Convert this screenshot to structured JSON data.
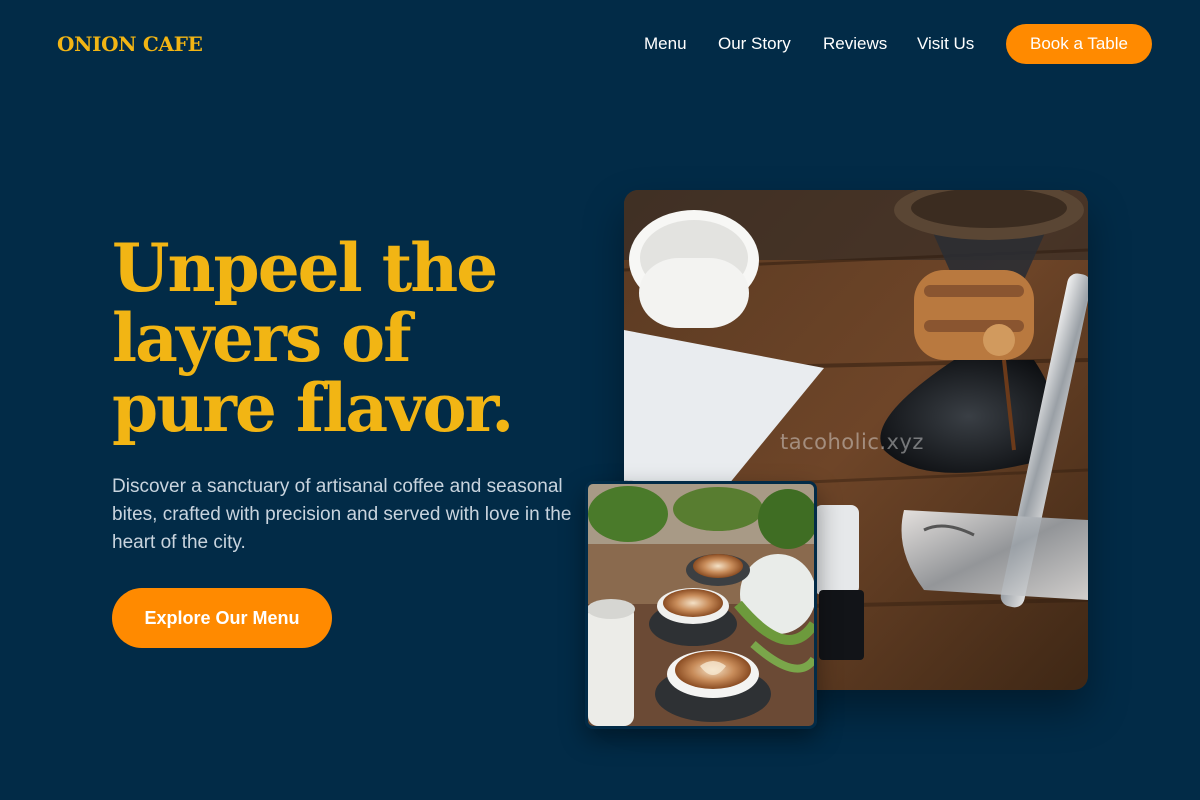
{
  "brand": {
    "name": "ONION CAFE"
  },
  "nav": {
    "items": [
      "Menu",
      "Our Story",
      "Reviews",
      "Visit Us"
    ],
    "cta_label": "Book a Table"
  },
  "hero": {
    "headline": "Unpeel the layers of pure flavor.",
    "description": "Discover a sanctuary of artisanal coffee and seasonal bites, crafted with precision and served with love in the heart of the city.",
    "cta_label": "Explore Our Menu"
  },
  "images": {
    "watermark_text": "tacoholic.xyz"
  },
  "colors": {
    "background": "#022b47",
    "accent_yellow": "#f2b514",
    "accent_orange": "#ff8a00"
  }
}
